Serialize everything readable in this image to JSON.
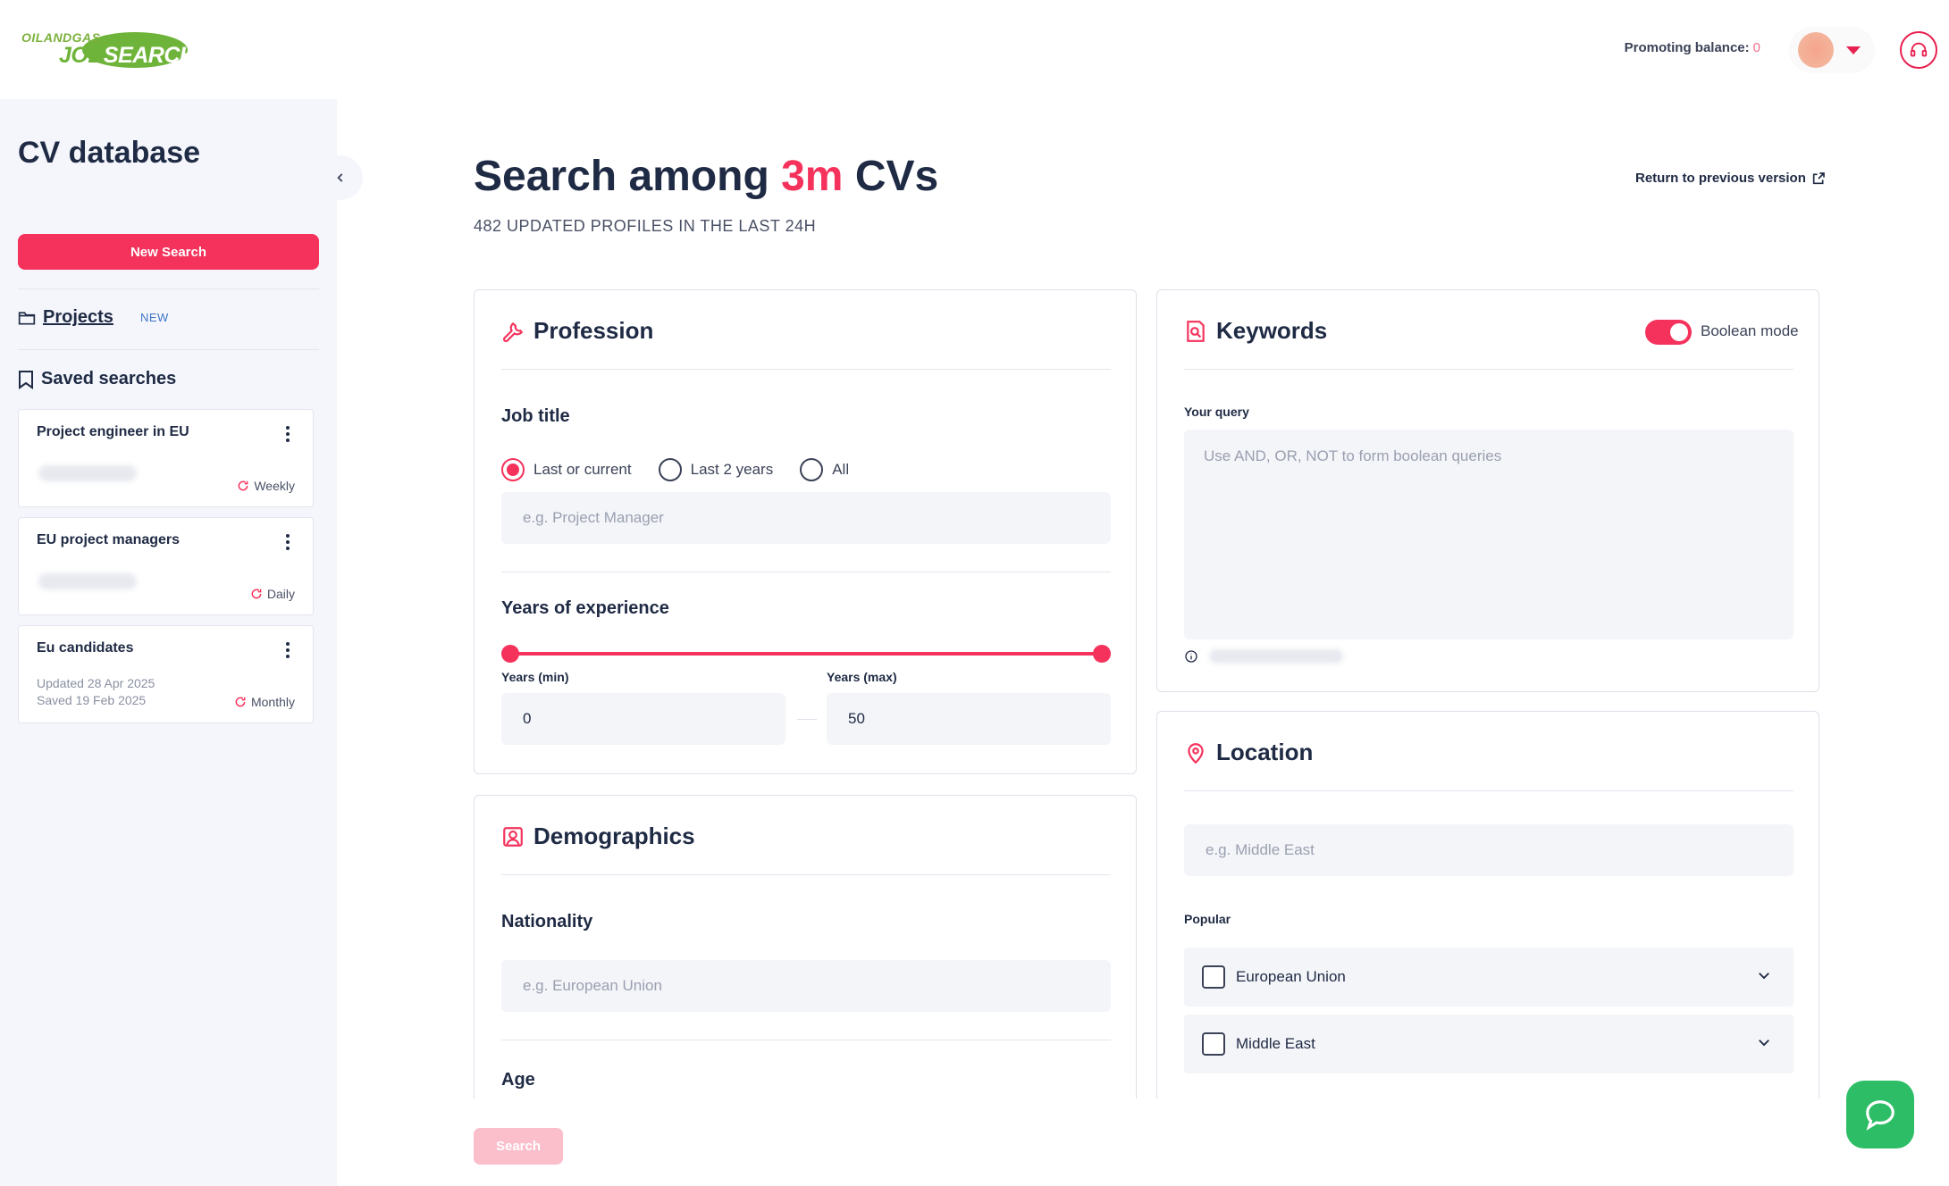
{
  "brand": {
    "logo_top": "OILANDGAS",
    "logo_job": "JOB",
    "logo_search": "SEARCH"
  },
  "header": {
    "promoting_label": "Promoting balance:",
    "promoting_value": "0"
  },
  "sidebar": {
    "title": "CV database",
    "new_search": "New Search",
    "projects_label": "Projects",
    "projects_badge": "NEW",
    "saved_label": "Saved searches",
    "saved": [
      {
        "name": "Project engineer in EU",
        "frequency": "Weekly"
      },
      {
        "name": "EU project managers",
        "frequency": "Daily"
      },
      {
        "name": "Eu candidates",
        "updated_label": "Updated",
        "updated": "28 Apr 2025",
        "saved_label": "Saved",
        "saved": "19 Feb 2025",
        "frequency": "Monthly"
      }
    ]
  },
  "main": {
    "title_prefix": "Search among ",
    "title_accent": "3m",
    "title_suffix": " CVs",
    "subtitle": "482 UPDATED PROFILES IN THE LAST 24H",
    "return_link": "Return to previous version",
    "search_button": "Search"
  },
  "profession": {
    "title": "Profession",
    "job_title_label": "Job title",
    "options": [
      "Last or current",
      "Last 2 years",
      "All"
    ],
    "selected_option": "Last or current",
    "job_placeholder": "e.g. Project Manager",
    "experience_label": "Years of experience",
    "min_label": "Years (min)",
    "max_label": "Years (max)",
    "min_value": "0",
    "max_value": "50"
  },
  "demographics": {
    "title": "Demographics",
    "nationality_label": "Nationality",
    "nationality_placeholder": "e.g. European Union",
    "age_label": "Age"
  },
  "keywords": {
    "title": "Keywords",
    "boolean_label": "Boolean mode",
    "boolean_on": true,
    "query_label": "Your query",
    "query_placeholder": "Use AND, OR, NOT to form boolean queries"
  },
  "location": {
    "title": "Location",
    "placeholder": "e.g. Middle East",
    "popular_label": "Popular",
    "items": [
      "European Union",
      "Middle East"
    ]
  },
  "colors": {
    "accent": "#f5325c",
    "brand_green": "#6fb43a",
    "chat": "#2ebd67"
  }
}
